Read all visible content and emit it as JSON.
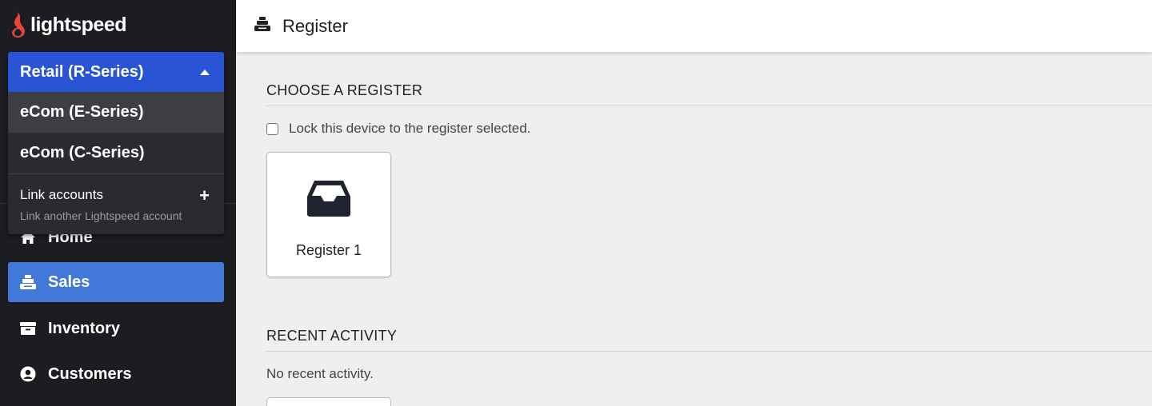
{
  "brand": {
    "name": "lightspeed"
  },
  "account_switcher": {
    "selected": "Retail (R-Series)",
    "options": [
      "eCom (E-Series)",
      "eCom (C-Series)"
    ],
    "link_title": "Link accounts",
    "link_subtitle": "Link another Lightspeed account"
  },
  "nav": {
    "home": "Home",
    "sales": "Sales",
    "inventory": "Inventory",
    "customers": "Customers"
  },
  "header": {
    "title": "Register"
  },
  "choose": {
    "title": "CHOOSE A REGISTER",
    "lock_label": "Lock this device to the register selected.",
    "registers": [
      "Register 1"
    ]
  },
  "recent": {
    "title": "RECENT ACTIVITY",
    "empty_text": "No recent activity."
  },
  "colors": {
    "sidebar_bg": "#1c1d21",
    "dropdown_selected": "#2a54d6",
    "nav_active": "#4279d8",
    "page_bg": "#efefef"
  }
}
